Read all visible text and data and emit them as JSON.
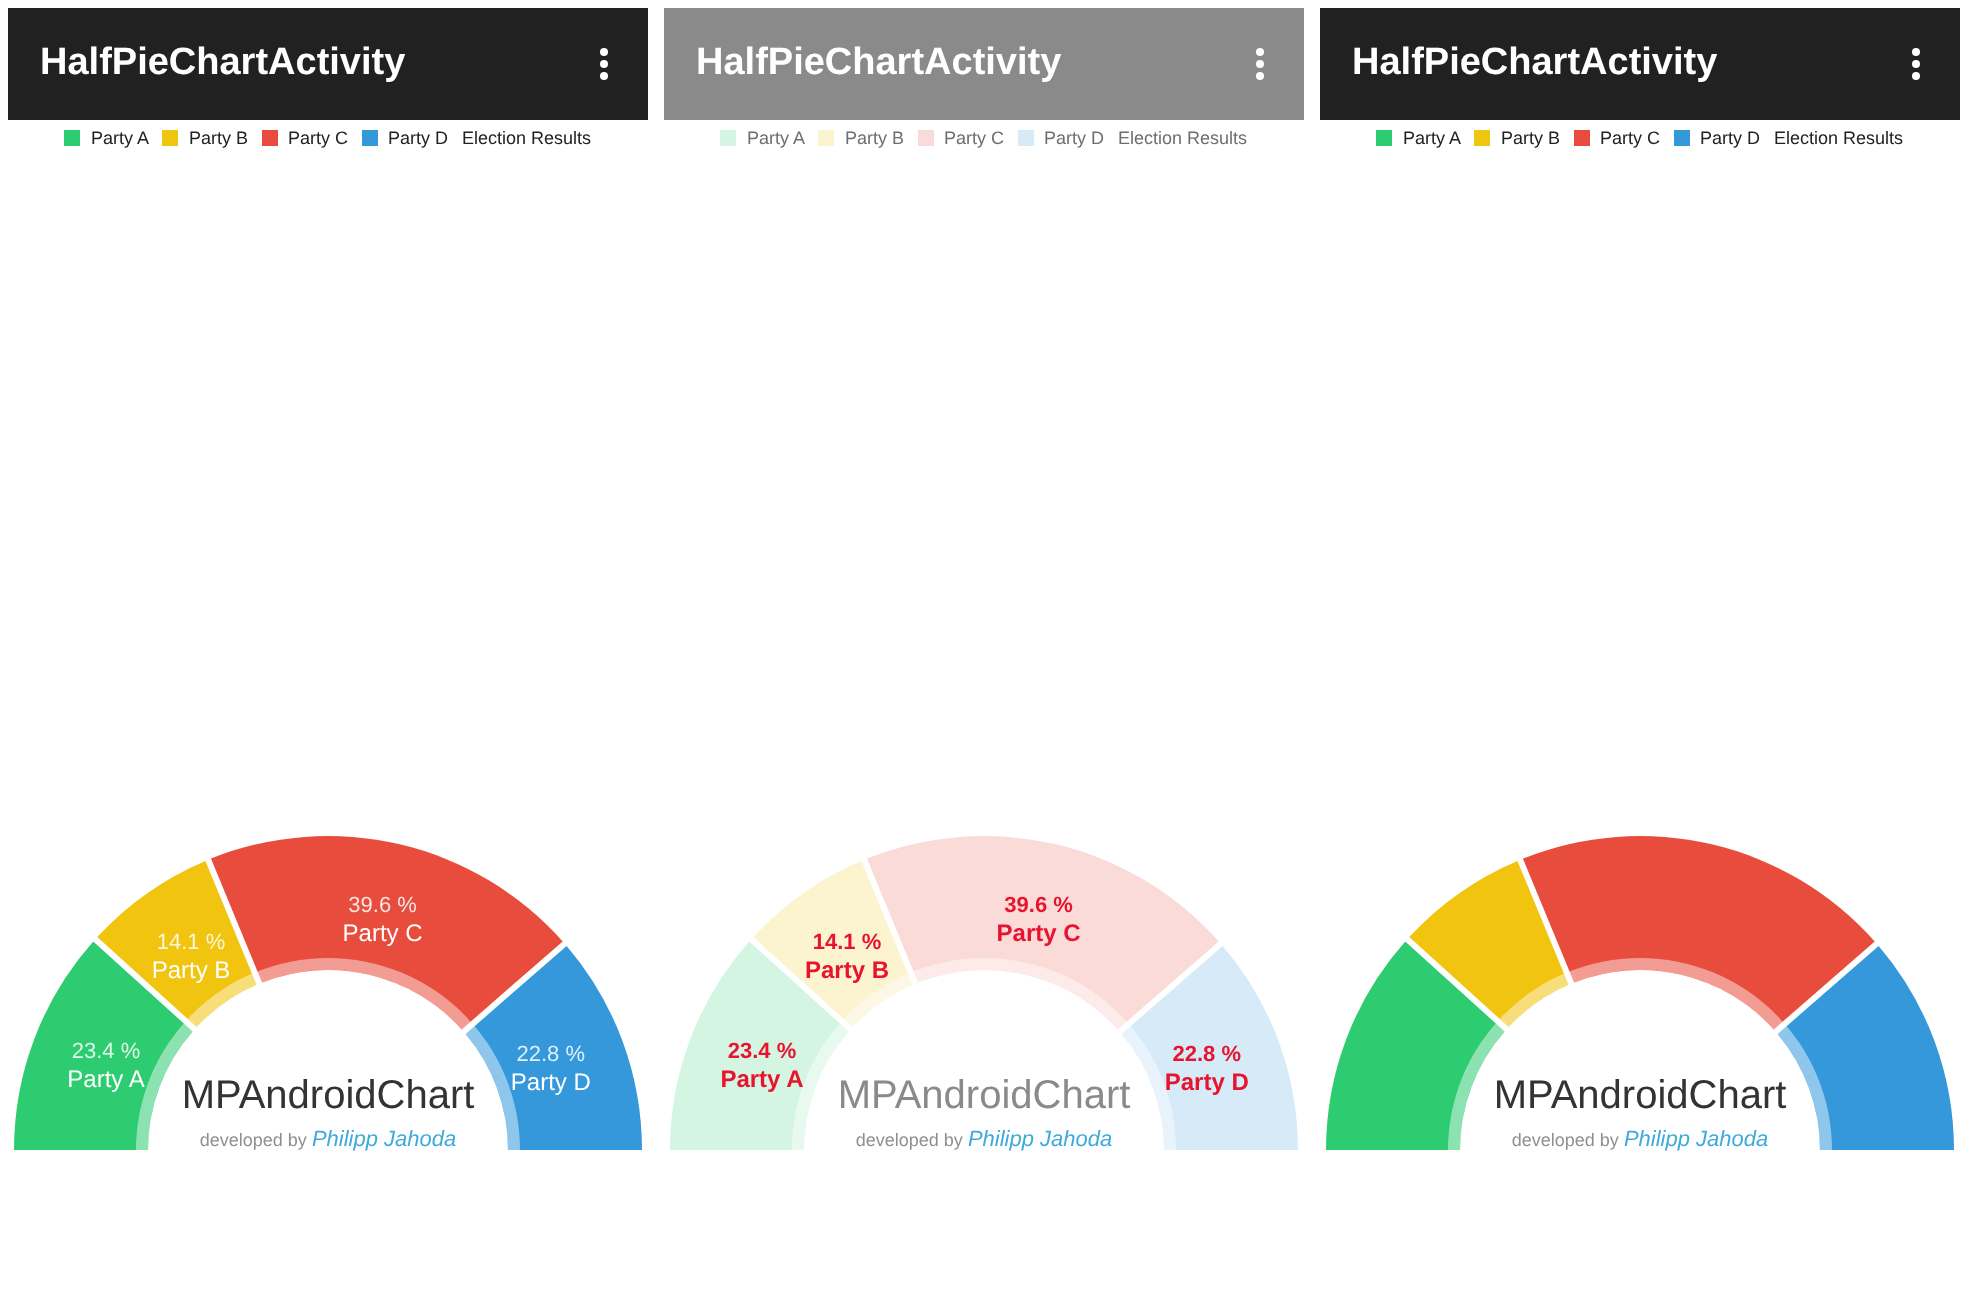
{
  "screens": [
    {
      "dimmed": false,
      "app_bar": {
        "title": "HalfPieChartActivity"
      },
      "legend": {
        "entries": [
          {
            "label": "Party A",
            "color": "#2ecc71"
          },
          {
            "label": "Party B",
            "color": "#f1c40f"
          },
          {
            "label": "Party C",
            "color": "#e74c3c"
          },
          {
            "label": "Party D",
            "color": "#3498db"
          }
        ],
        "description": "Election Results"
      },
      "chart": {
        "center_title": "MPAndroidChart",
        "center_subtitle": "developed by *Philipp Jahoda*",
        "emphasized_labels": false,
        "chart_data": {
          "type": "donut",
          "categories": [
            "Party A",
            "Party B",
            "Party C",
            "Party D"
          ],
          "values": [
            23.4,
            14.1,
            39.6,
            22.8
          ],
          "value_labels": [
            "23.4 %",
            "14.1 %",
            "39.6 %",
            "22.8 %"
          ]
        }
      }
    },
    {
      "dimmed": true,
      "app_bar": {
        "title": "HalfPieChartActivity"
      },
      "legend": {
        "entries": [
          {
            "label": "Party A",
            "color": "#d5f5e3"
          },
          {
            "label": "Party B",
            "color": "#fcf3cf"
          },
          {
            "label": "Party C",
            "color": "#fadbd8"
          },
          {
            "label": "Party D",
            "color": "#d6eaf8"
          }
        ],
        "description": "Election Results"
      },
      "chart": {
        "center_title": "MPAndroidChart",
        "center_subtitle": "developed by *Philipp Jahoda*",
        "emphasized_labels": true,
        "chart_data": {
          "type": "donut",
          "categories": [
            "Party A",
            "Party B",
            "Party C",
            "Party D"
          ],
          "values": [
            23.4,
            14.1,
            39.6,
            22.8
          ],
          "value_labels": [
            "23.4 %",
            "14.1 %",
            "39.6 %",
            "22.8 %"
          ]
        }
      }
    },
    {
      "dimmed": false,
      "app_bar": {
        "title": "HalfPieChartActivity"
      },
      "legend": {
        "entries": [
          {
            "label": "Party A",
            "color": "#2ecc71"
          },
          {
            "label": "Party B",
            "color": "#f1c40f"
          },
          {
            "label": "Party C",
            "color": "#e74c3c"
          },
          {
            "label": "Party D",
            "color": "#3498db"
          }
        ],
        "description": "Election Results"
      },
      "chart": {
        "center_title": "MPAndroidChart",
        "center_subtitle": "developed by *Philipp Jahoda*",
        "chart_data": {
          "type": "donut",
          "values": [
            23.4,
            14.1,
            39.6,
            22.8
          ]
        }
      }
    }
  ]
}
